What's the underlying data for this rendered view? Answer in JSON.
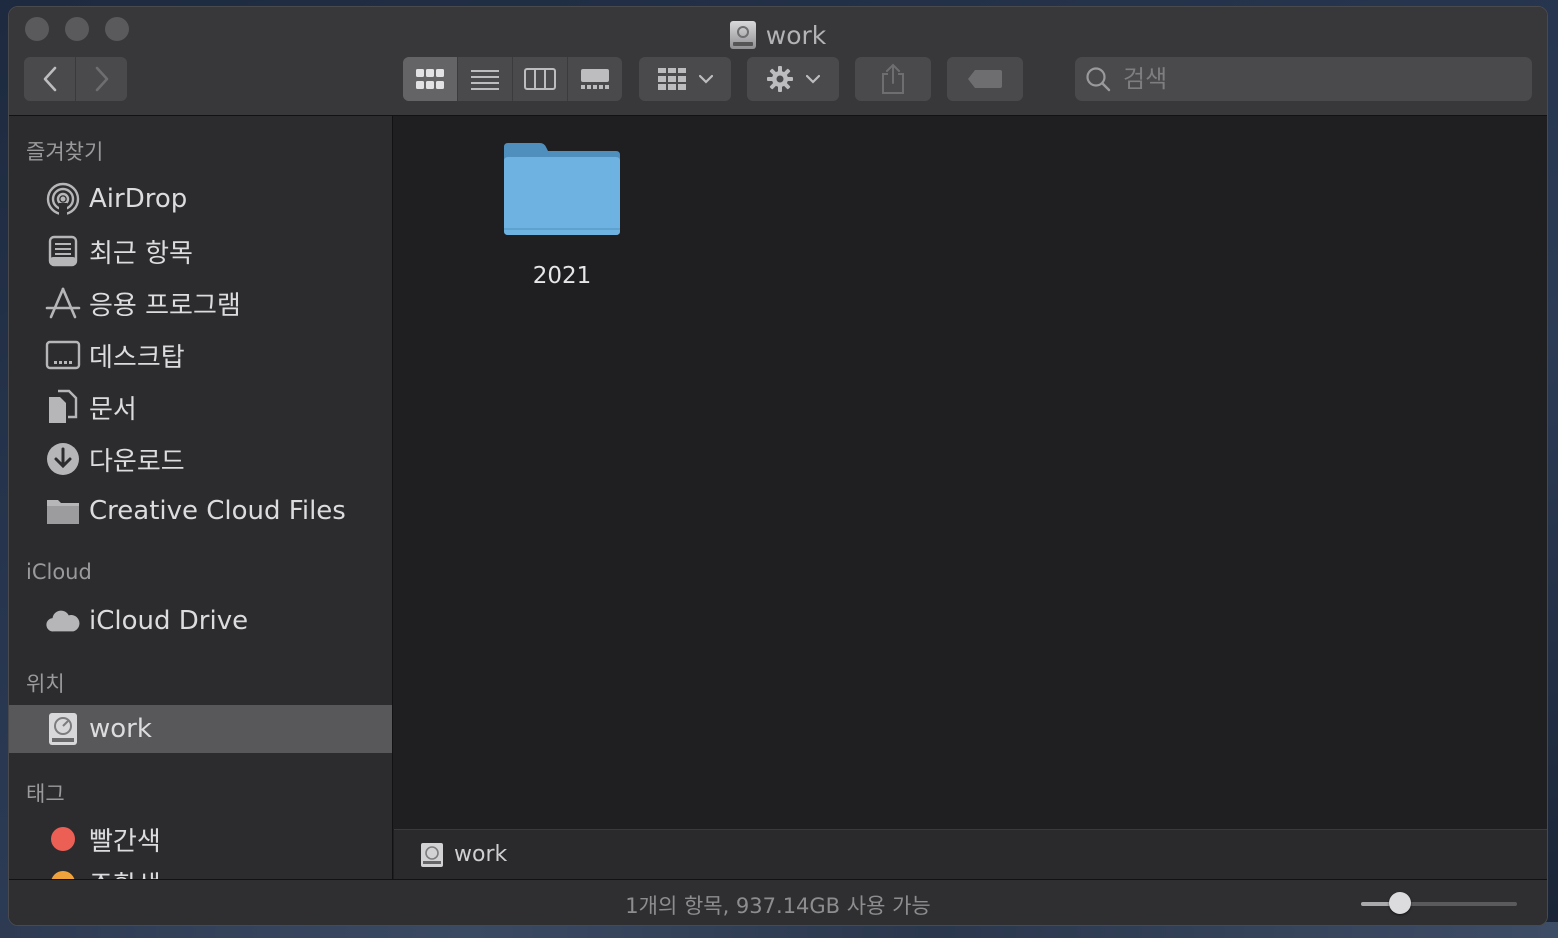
{
  "window": {
    "title": "work"
  },
  "toolbar": {
    "back_icon": "chevron-left-icon",
    "forward_icon": "chevron-right-icon",
    "views": [
      "icon-view",
      "list-view",
      "column-view",
      "gallery-view"
    ],
    "active_view": "icon-view",
    "search_placeholder": "검색"
  },
  "sidebar": {
    "favorites_header": "즐겨찾기",
    "favorites": [
      {
        "label": "AirDrop",
        "icon": "airdrop-icon"
      },
      {
        "label": "최근 항목",
        "icon": "recents-icon"
      },
      {
        "label": "응용 프로그램",
        "icon": "applications-icon"
      },
      {
        "label": "데스크탑",
        "icon": "desktop-icon"
      },
      {
        "label": "문서",
        "icon": "documents-icon"
      },
      {
        "label": "다운로드",
        "icon": "downloads-icon"
      },
      {
        "label": "Creative Cloud Files",
        "icon": "folder-icon"
      }
    ],
    "icloud_header": "iCloud",
    "icloud": [
      {
        "label": "iCloud Drive",
        "icon": "cloud-icon"
      }
    ],
    "locations_header": "위치",
    "locations": [
      {
        "label": "work",
        "icon": "drive-icon",
        "selected": true
      }
    ],
    "tags_header": "태그",
    "tags": [
      {
        "label": "빨간색",
        "color": "#ec5f55"
      },
      {
        "label": "주황색",
        "color": "#f0a33a"
      }
    ]
  },
  "main": {
    "items": [
      {
        "name": "2021",
        "icon": "folder-icon",
        "color": "#6db2e0"
      }
    ]
  },
  "pathbar": {
    "label": "work"
  },
  "status": {
    "text": "1개의 항목, 937.14GB 사용 가능",
    "icon_size_fraction": 0.25
  },
  "colors": {
    "selection": "#58585a",
    "folder_blue": "#6db2e0"
  }
}
